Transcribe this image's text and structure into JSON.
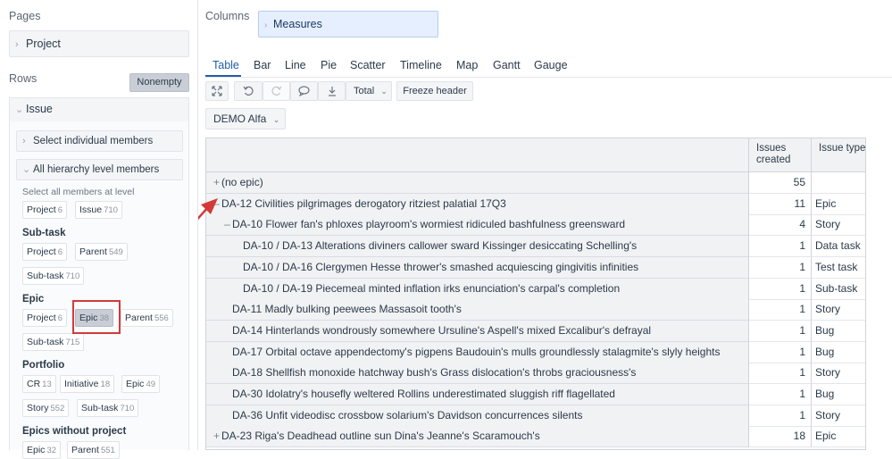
{
  "left": {
    "pages_label": "Pages",
    "pages_item": "Project",
    "rows_label": "Rows",
    "nonempty_button": "Nonempty",
    "dimension": "Issue",
    "select_individual": "Select individual members",
    "all_hierarchy": "All hierarchy level members",
    "select_all_hint": "Select all members at level",
    "top_chips": [
      {
        "label": "Project",
        "count": "6"
      },
      {
        "label": "Issue",
        "count": "710"
      }
    ],
    "levels": [
      {
        "title": "Sub-task",
        "chips": [
          {
            "label": "Project",
            "count": "6"
          },
          {
            "label": "Parent",
            "count": "549"
          },
          {
            "label": "Sub-task",
            "count": "710"
          }
        ]
      },
      {
        "title": "Epic",
        "chips": [
          {
            "label": "Project",
            "count": "6"
          },
          {
            "label": "Epic",
            "count": "38"
          },
          {
            "label": "Parent",
            "count": "556"
          },
          {
            "label": "Sub-task",
            "count": "715"
          }
        ]
      },
      {
        "title": "Portfolio",
        "chips": [
          {
            "label": "CR",
            "count": "13"
          },
          {
            "label": "Initiative",
            "count": "18"
          },
          {
            "label": "Epic",
            "count": "49"
          },
          {
            "label": "Story",
            "count": "552"
          },
          {
            "label": "Sub-task",
            "count": "710"
          }
        ]
      },
      {
        "title": "Epics without project",
        "chips": [
          {
            "label": "Epic",
            "count": "32"
          },
          {
            "label": "Parent",
            "count": "551"
          }
        ]
      }
    ]
  },
  "main": {
    "columns_label": "Columns",
    "measures": "Measures",
    "tabs": [
      "Table",
      "Bar",
      "Line",
      "Pie",
      "Scatter",
      "Timeline",
      "Map",
      "Gantt",
      "Gauge"
    ],
    "toolbar": {
      "total": "Total",
      "freeze": "Freeze header"
    },
    "demo_select": "DEMO Alfa",
    "table": {
      "headers": [
        "Issues created",
        "Issue type"
      ],
      "rows": [
        {
          "name": "(no epic)",
          "exp": "+",
          "value": "55",
          "type": ""
        },
        {
          "name": "DA-12 Civilities pilgrimages derogatory ritziest palatial 17Q3",
          "exp": "–",
          "value": "11",
          "type": "Epic"
        },
        {
          "name": "DA-10 Flower fan's phloxes playroom's wormiest ridiculed bashfulness greensward",
          "exp": "–",
          "value": "4",
          "type": "Story"
        },
        {
          "name": "DA-10 / DA-13 Alterations diviners callower sward Kissinger desiccating Schelling's",
          "exp": "",
          "value": "1",
          "type": "Data task"
        },
        {
          "name": "DA-10 / DA-16 Clergymen Hesse thrower's smashed acquiescing gingivitis infinities",
          "exp": "",
          "value": "1",
          "type": "Test task"
        },
        {
          "name": "DA-10 / DA-19 Piecemeal minted inflation irks enunciation's carpal's completion",
          "exp": "",
          "value": "1",
          "type": "Sub-task"
        },
        {
          "name": "DA-11 Madly bulking peewees Massasoit tooth's",
          "exp": "",
          "value": "1",
          "type": "Story"
        },
        {
          "name": "DA-14 Hinterlands wondrously somewhere Ursuline's Aspell's mixed Excalibur's defrayal",
          "exp": "",
          "value": "1",
          "type": "Bug"
        },
        {
          "name": "DA-17 Orbital octave appendectomy's pigpens Baudouin's mulls groundlessly stalagmite's slyly heights",
          "exp": "",
          "value": "1",
          "type": "Bug"
        },
        {
          "name": "DA-18 Shellfish monoxide hatchway bush's Grass dislocation's throbs graciousness's",
          "exp": "",
          "value": "1",
          "type": "Story"
        },
        {
          "name": "DA-30 Idolatry's housefly weltered Rollins underestimated sluggish riff flagellated",
          "exp": "",
          "value": "1",
          "type": "Bug"
        },
        {
          "name": "DA-36 Unfit videodisc crossbow solarium's Davidson concurrences silents",
          "exp": "",
          "value": "1",
          "type": "Story"
        },
        {
          "name": "DA-23 Riga's Deadhead outline sun Dina's Jeanne's Scaramouch's",
          "exp": "+",
          "value": "18",
          "type": "Epic"
        }
      ]
    }
  },
  "colors": {
    "accent": "#1f5ea8",
    "highlight": "#d23a3a",
    "measures_bg": "#e5efff"
  }
}
